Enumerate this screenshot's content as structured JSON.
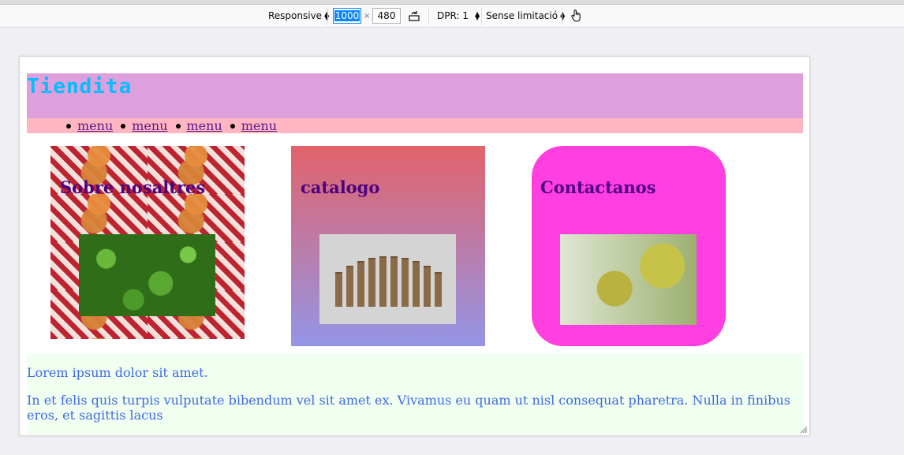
{
  "toolbar": {
    "device": "Responsive",
    "width": "1000",
    "times": "×",
    "height": "480",
    "dpr": "DPR: 1",
    "throttling": "Sense limitació"
  },
  "site": {
    "title": "Tiendita",
    "menu": [
      "menu",
      "menu",
      "menu",
      "menu"
    ],
    "cards": [
      {
        "title": "Sobre nosaltres"
      },
      {
        "title": "catalogo"
      },
      {
        "title": "Contactanos"
      }
    ],
    "paragraphs": [
      "Lorem ipsum dolor sit amet.",
      "In et felis quis turpis vulputate bibendum vel sit amet ex. Vivamus eu quam ut nisl consequat pharetra. Nulla in finibus eros, et sagittis lacus"
    ]
  },
  "colors": {
    "header_bg": "#dda0dd",
    "title": "#00bfff",
    "nav_bg": "#ffb6c1",
    "card_title": "#4b0082",
    "contact_bg": "#ff3fe0",
    "catalog_gradient": [
      "#e2636b",
      "#9495e6"
    ],
    "text_bg": "#f0fff0",
    "text": "#4169e1"
  },
  "icons": {
    "rotate": "rotate-icon",
    "touch": "touch-icon",
    "resize": "resize-handle-icon"
  }
}
